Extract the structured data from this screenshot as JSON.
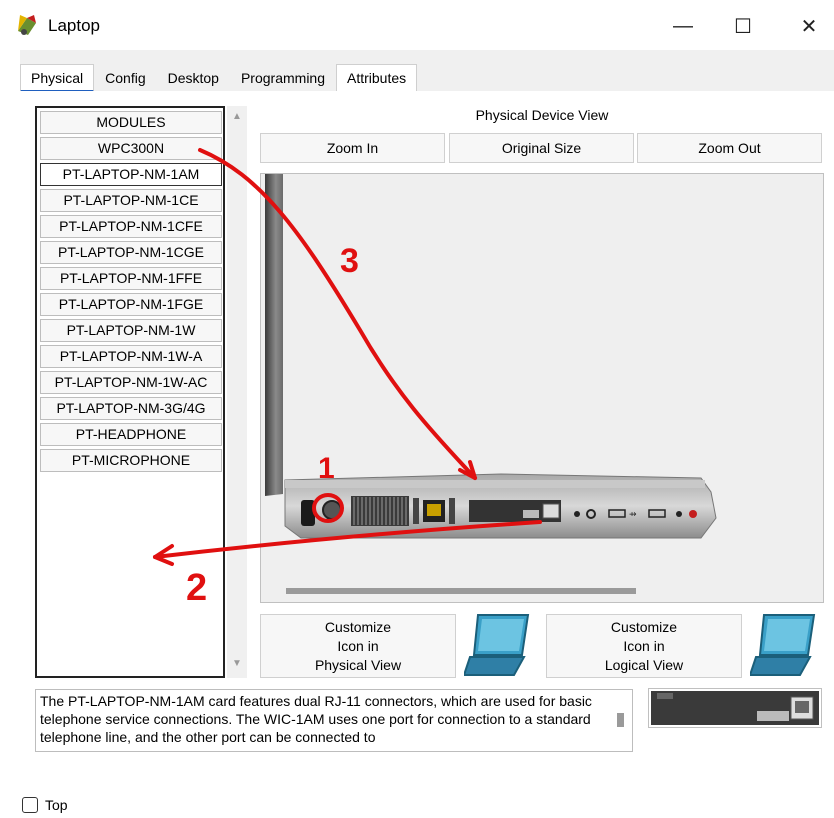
{
  "window": {
    "title": "Laptop",
    "minimize": "—",
    "maximize": "☐",
    "close": "✕"
  },
  "tabs": [
    {
      "label": "Physical"
    },
    {
      "label": "Config"
    },
    {
      "label": "Desktop"
    },
    {
      "label": "Programming"
    },
    {
      "label": "Attributes"
    }
  ],
  "modules": [
    "MODULES",
    "WPC300N",
    "PT-LAPTOP-NM-1AM",
    "PT-LAPTOP-NM-1CE",
    "PT-LAPTOP-NM-1CFE",
    "PT-LAPTOP-NM-1CGE",
    "PT-LAPTOP-NM-1FFE",
    "PT-LAPTOP-NM-1FGE",
    "PT-LAPTOP-NM-1W",
    "PT-LAPTOP-NM-1W-A",
    "PT-LAPTOP-NM-1W-AC",
    "PT-LAPTOP-NM-3G/4G",
    "PT-HEADPHONE",
    "PT-MICROPHONE"
  ],
  "device_view": {
    "title": "Physical Device View",
    "zoom_in": "Zoom In",
    "original_size": "Original Size",
    "zoom_out": "Zoom Out"
  },
  "customize": {
    "physical_l1": "Customize",
    "physical_l2": "Icon in",
    "physical_l3": "Physical View",
    "logical_l1": "Customize",
    "logical_l2": "Icon in",
    "logical_l3": "Logical View"
  },
  "description": "The PT-LAPTOP-NM-1AM card features dual RJ-11 connectors, which are used for basic telephone service connections. The WIC-1AM uses one port for connection to a standard telephone line, and the other port can be connected to",
  "annotations": {
    "one": "1",
    "two": "2",
    "three": "3"
  },
  "bottom": {
    "top_label": "Top"
  },
  "colors": {
    "active_tab_underline": "#1f5fbf",
    "annotation_red": "#e01010"
  }
}
